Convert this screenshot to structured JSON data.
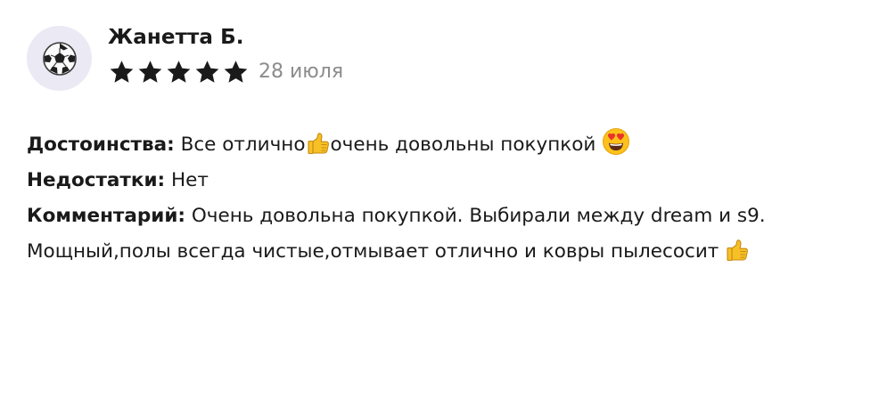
{
  "review": {
    "author": "Жанетта Б.",
    "rating": 5,
    "rating_max": 5,
    "date": "28 июля",
    "avatar_icon": "soccer-ball-icon",
    "pros": {
      "label": "Достоинства:",
      "text_before_emoji": " Все отлично",
      "text_after_emoji": "очень довольны покупкой ",
      "emojis": [
        "thumbs-up-icon",
        "heart-eyes-icon"
      ]
    },
    "cons": {
      "label": "Недостатки:",
      "text": " Нет"
    },
    "comment": {
      "label": "Комментарий:",
      "text_line1": " Очень довольна покупкой. Выбирали между dream и s9.",
      "text_line2": "Мощный,полы всегда чистые,отмывает отлично и ковры пылесосит ",
      "emojis": [
        "thumbs-up-icon"
      ]
    }
  },
  "colors": {
    "star": "#1a1a1a",
    "avatar_bg": "#ebe9f4",
    "date": "#8c8c8c",
    "thumb": "#f6c026"
  }
}
